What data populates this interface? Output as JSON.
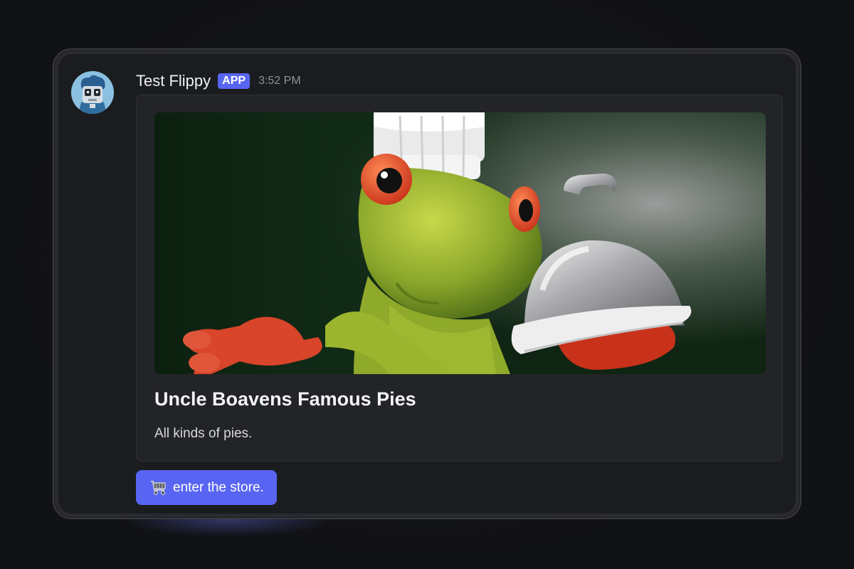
{
  "message": {
    "username": "Test Flippy",
    "badge": "APP",
    "timestamp": "3:52 PM",
    "avatar_icon": "robot-avatar"
  },
  "embed": {
    "image_subject": "frog-chef-figurine",
    "title": "Uncle Boavens Famous Pies",
    "description": "All kinds of pies."
  },
  "button": {
    "icon": "shopping-cart-icon",
    "label": "enter the store."
  },
  "colors": {
    "accent": "#5865f2",
    "background": "#1b1c20",
    "embed_background": "#232428"
  }
}
